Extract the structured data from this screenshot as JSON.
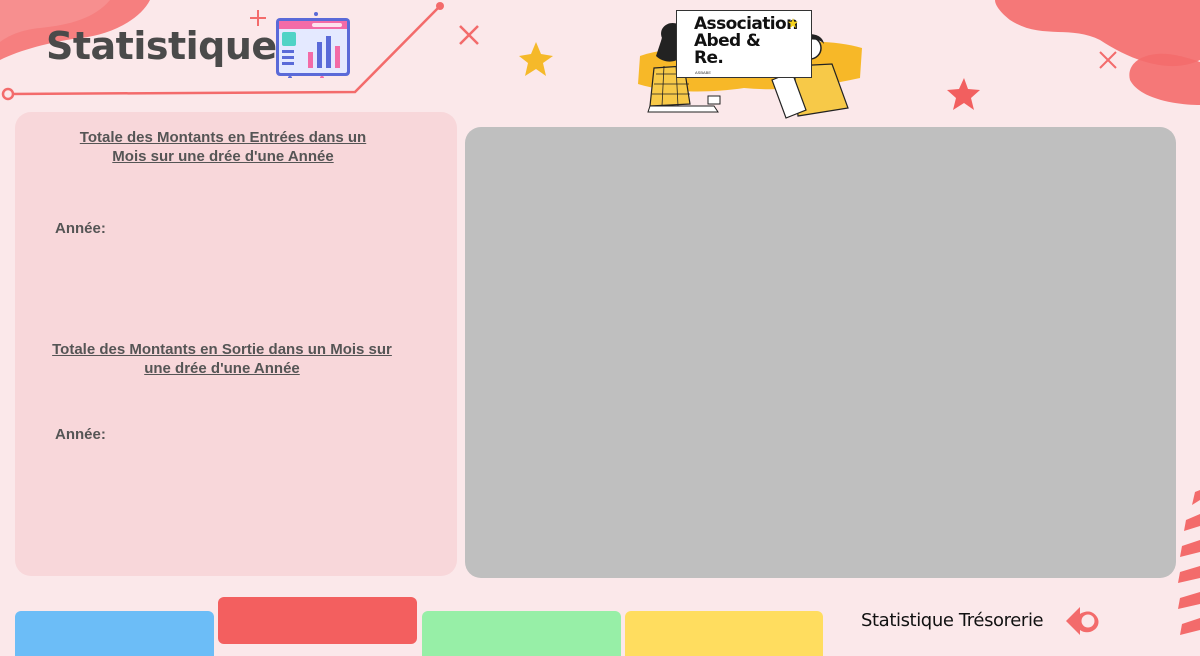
{
  "header": {
    "title": "Statistique",
    "chart_icon": "dashboard-chart-icon"
  },
  "logo": {
    "text": "Association\nAbed &\nRe.",
    "subtext": "ASBABE"
  },
  "left_panel": {
    "entries_heading": "Totale des Montants en Entrées dans un Mois sur une drée d'une Année",
    "entries_year_label": "Année:",
    "exits_heading": "Totale des Montants en Sortie dans un Mois sur une drée d'une Année",
    "exits_year_label": "Année:"
  },
  "footer": {
    "label": "Statistique Trésorerie",
    "back_icon": "back-arrow-icon"
  },
  "colors": {
    "background": "#fbe8ea",
    "panel": "#f8d7da",
    "main_area": "#bfbfbf",
    "tab_blue": "#6cbdf7",
    "tab_red": "#f35f5f",
    "tab_green": "#97efa7",
    "tab_yellow": "#ffdd5f",
    "accent": "#f36b6b",
    "star": "#f5b92a"
  }
}
